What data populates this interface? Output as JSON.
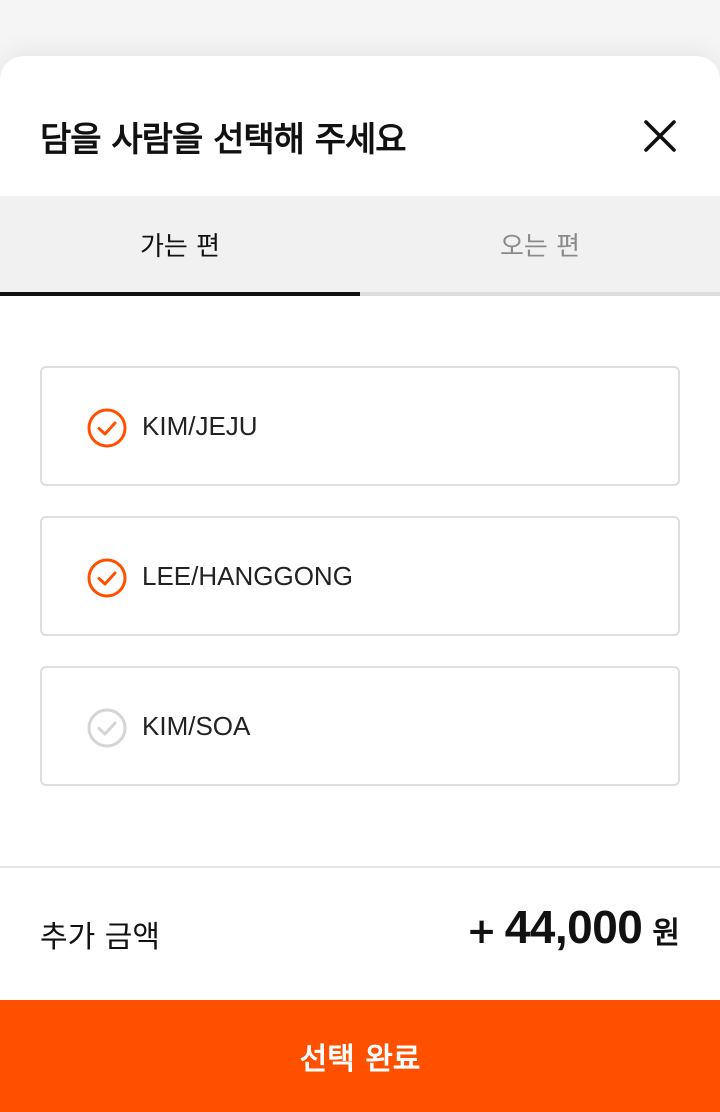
{
  "sheet": {
    "title": "담을 사람을 선택해 주세요"
  },
  "tabs": [
    {
      "label": "가는 편",
      "active": true
    },
    {
      "label": "오는 편",
      "active": false
    }
  ],
  "passengers": [
    {
      "name": "KIM/JEJU",
      "selected": true
    },
    {
      "name": "LEE/HANGGONG",
      "selected": true
    },
    {
      "name": "KIM/SOA",
      "selected": false
    }
  ],
  "summary": {
    "label": "추가 금액",
    "sign": "+",
    "amount": "44,000",
    "unit": "원"
  },
  "cta": {
    "label": "선택 완료"
  },
  "colors": {
    "accent": "#ff5000",
    "check_selected": "#ff5000",
    "check_unselected": "#d5d5d5"
  },
  "icons": {
    "close": "close-icon",
    "check": "check-circle-icon"
  }
}
